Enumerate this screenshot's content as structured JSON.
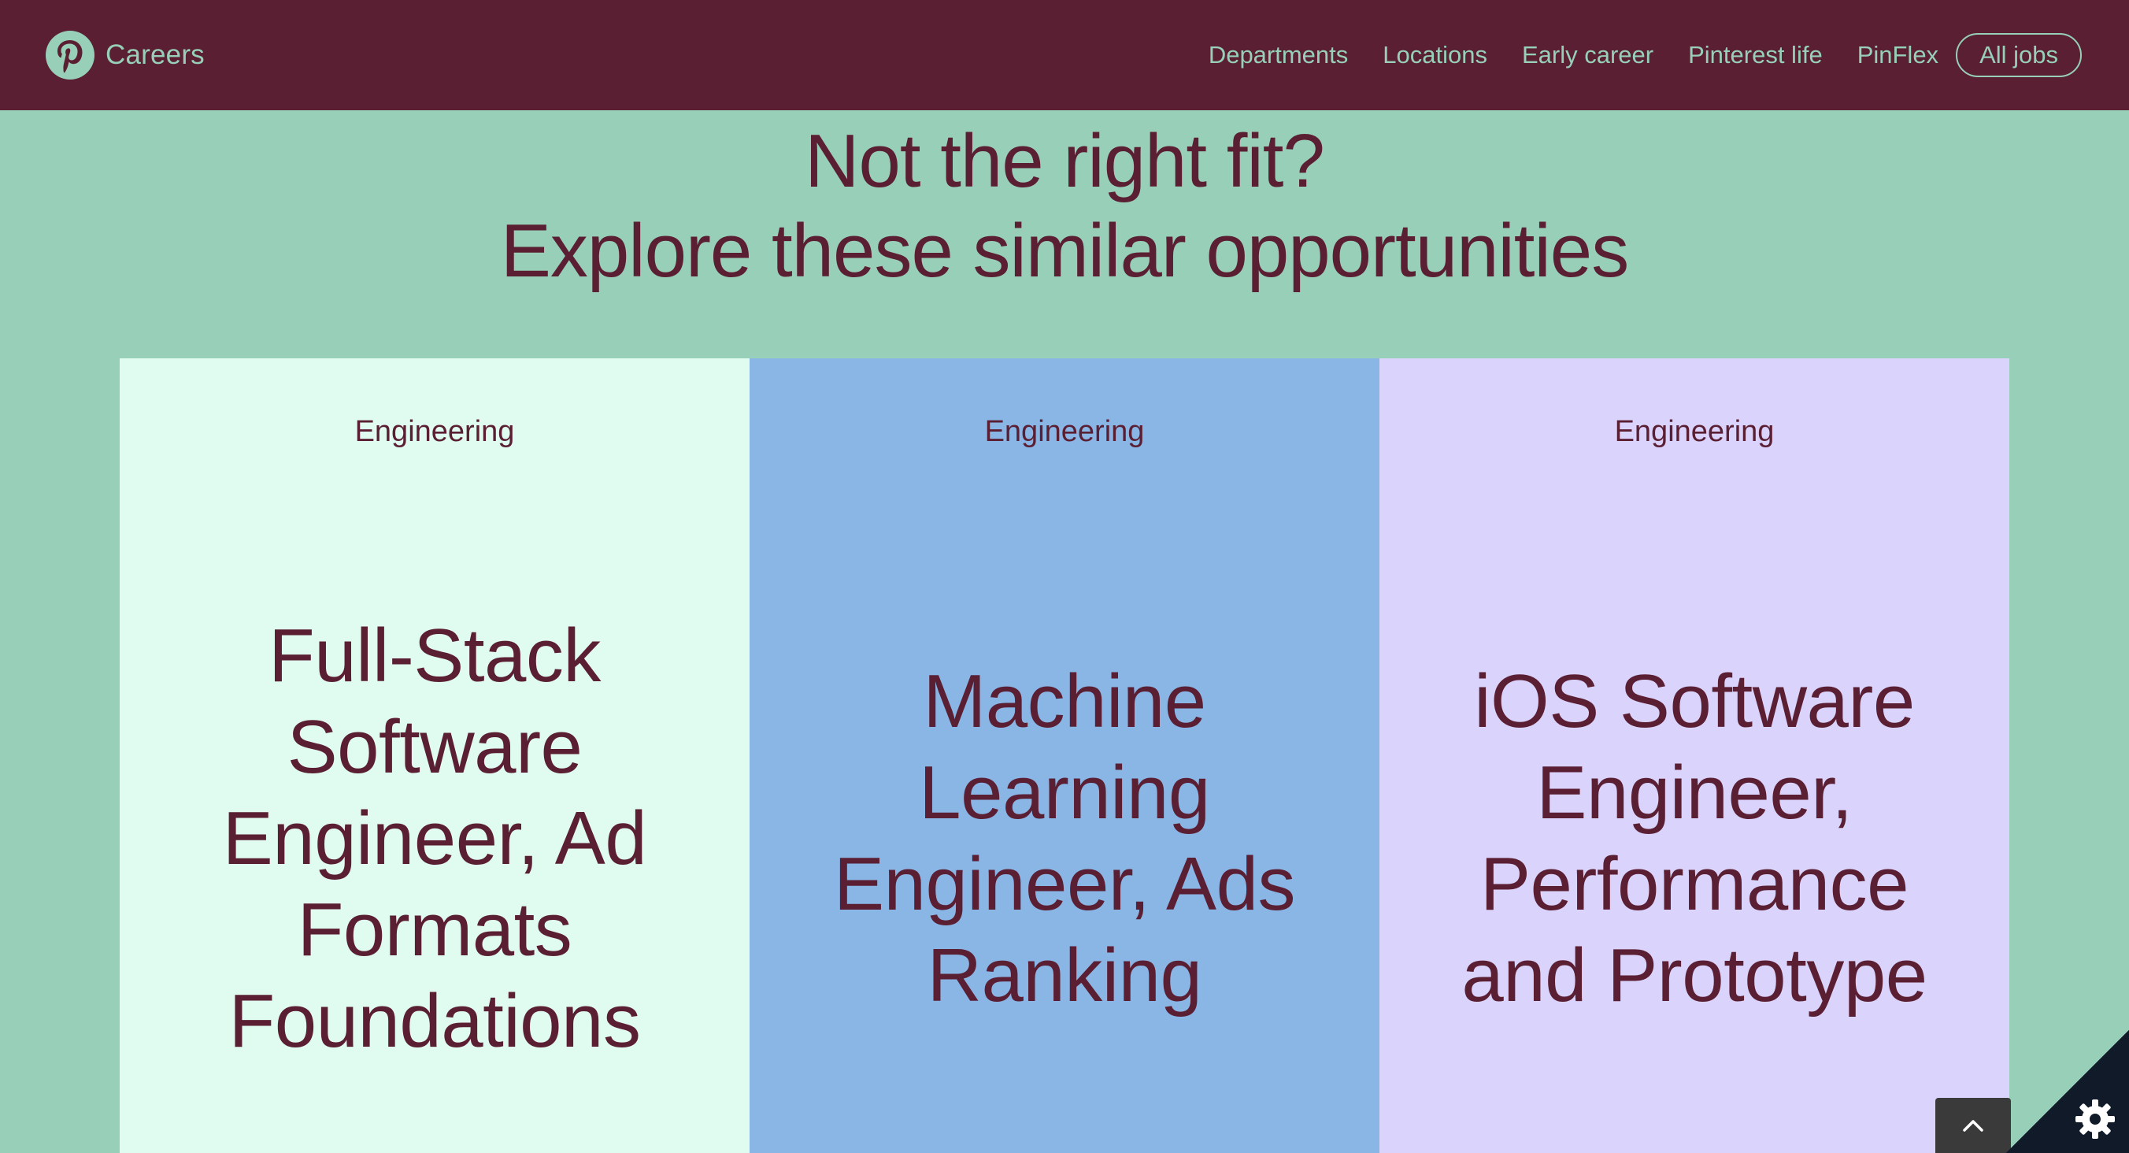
{
  "header": {
    "brand_label": "Careers",
    "logo_icon": "pinterest-logo-icon",
    "nav": [
      "Departments",
      "Locations",
      "Early career",
      "Pinterest life",
      "PinFlex"
    ],
    "cta": "All jobs"
  },
  "section": {
    "heading_line1": "Not the right fit?",
    "heading_line2": "Explore these similar opportunities"
  },
  "cards": [
    {
      "department": "Engineering",
      "title": "Full-Stack Software Engineer, Ad Formats Foundations",
      "color": "#e0fbef"
    },
    {
      "department": "Engineering",
      "title": "Machine Learning Engineer, Ads Ranking",
      "color": "#8ab6e6"
    },
    {
      "department": "Engineering",
      "title": "iOS Software Engineer, Performance and Prototype",
      "color": "#dad3fb"
    }
  ],
  "floating": {
    "scroll_top_icon": "chevron-up-icon",
    "settings_icon": "gear-icon"
  },
  "colors": {
    "header_bg": "#5a1f33",
    "page_bg": "#97cfb8",
    "text": "#5a1f33",
    "accent": "#97cfb8"
  }
}
